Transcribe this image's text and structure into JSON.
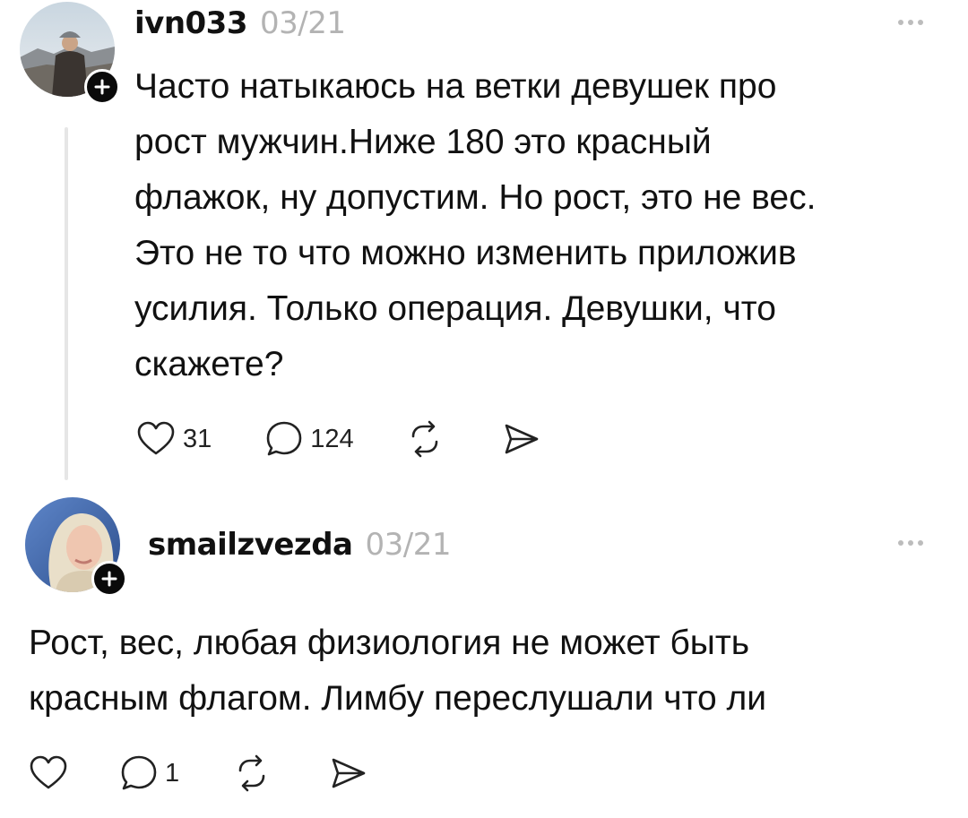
{
  "posts": [
    {
      "username": "ivn033",
      "date": "03/21",
      "text_lines": [
        "Часто натыкаюсь на ветки девушек про",
        "рост мужчин.Ниже 180 это красный",
        "флажок, ну допустим. Но рост, это не вес.",
        "Это не то что можно изменить приложив",
        "усилия. Только операция. Девушки, что",
        "скажете?"
      ],
      "likes": "31",
      "replies": "124",
      "reposts": "",
      "shares": ""
    },
    {
      "username": "smailzvezda",
      "date": "03/21",
      "text_lines": [
        "Рост, вес, любая физиология не может быть",
        "красным флагом. Лимбу переслушали что ли"
      ],
      "likes": "",
      "replies": "1",
      "reposts": "",
      "shares": ""
    }
  ],
  "icons": {
    "like": "heart-icon",
    "reply": "comment-icon",
    "repost": "repost-icon",
    "share": "send-icon",
    "more": "more-icon",
    "follow": "plus-icon"
  },
  "colors": {
    "text": "#111111",
    "muted": "#b3b3b3",
    "thread_line": "#e6e6e6",
    "badge": "#0a0a0a"
  }
}
